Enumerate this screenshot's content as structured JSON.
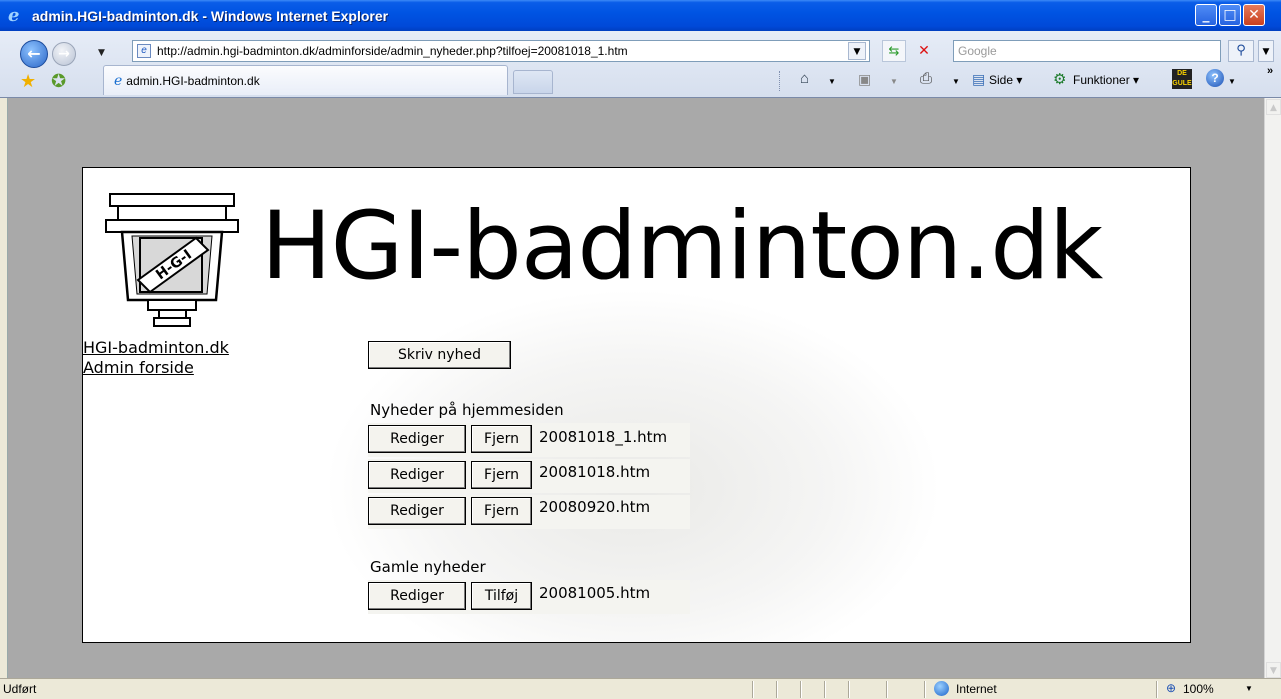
{
  "window": {
    "title": "admin.HGI-badminton.dk - Windows Internet Explorer",
    "controls": {
      "minimize": "_",
      "maximize": "□",
      "close": "✕"
    }
  },
  "toolbar": {
    "url": "http://admin.hgi-badminton.dk/adminforside/admin_nyheder.php?tilfoej=20081018_1.htm",
    "search_placeholder": "Google",
    "back_icon": "back-arrow-icon",
    "forward_icon": "forward-arrow-icon"
  },
  "tabs": [
    {
      "label": "admin.HGI-badminton.dk",
      "active": true
    }
  ],
  "commands": {
    "page_label": "Side",
    "tools_label": "Funktioner",
    "yellow_pages_icon": "DE GULE SIDER"
  },
  "page": {
    "site_heading": "HGI-badminton.dk",
    "logo_text": "H-G-I",
    "left_links": [
      "HGI-badminton.dk",
      "Admin forside"
    ],
    "write_news_button": "Skriv nyhed",
    "current_news": {
      "heading": "Nyheder på hjemmesiden",
      "rows": [
        {
          "edit": "Rediger",
          "remove": "Fjern",
          "file": "20081018_1.htm"
        },
        {
          "edit": "Rediger",
          "remove": "Fjern",
          "file": "20081018.htm"
        },
        {
          "edit": "Rediger",
          "remove": "Fjern",
          "file": "20080920.htm"
        }
      ]
    },
    "old_news": {
      "heading": "Gamle nyheder",
      "rows": [
        {
          "edit": "Rediger",
          "add": "Tilføj",
          "file": "20081005.htm"
        }
      ]
    }
  },
  "status": {
    "text": "Udført",
    "zone": "Internet",
    "zoom": "100%"
  },
  "colors": {
    "titlebar": "#0054e3",
    "content_bg": "#a9a9a9",
    "page_bg": "#ffffff"
  }
}
